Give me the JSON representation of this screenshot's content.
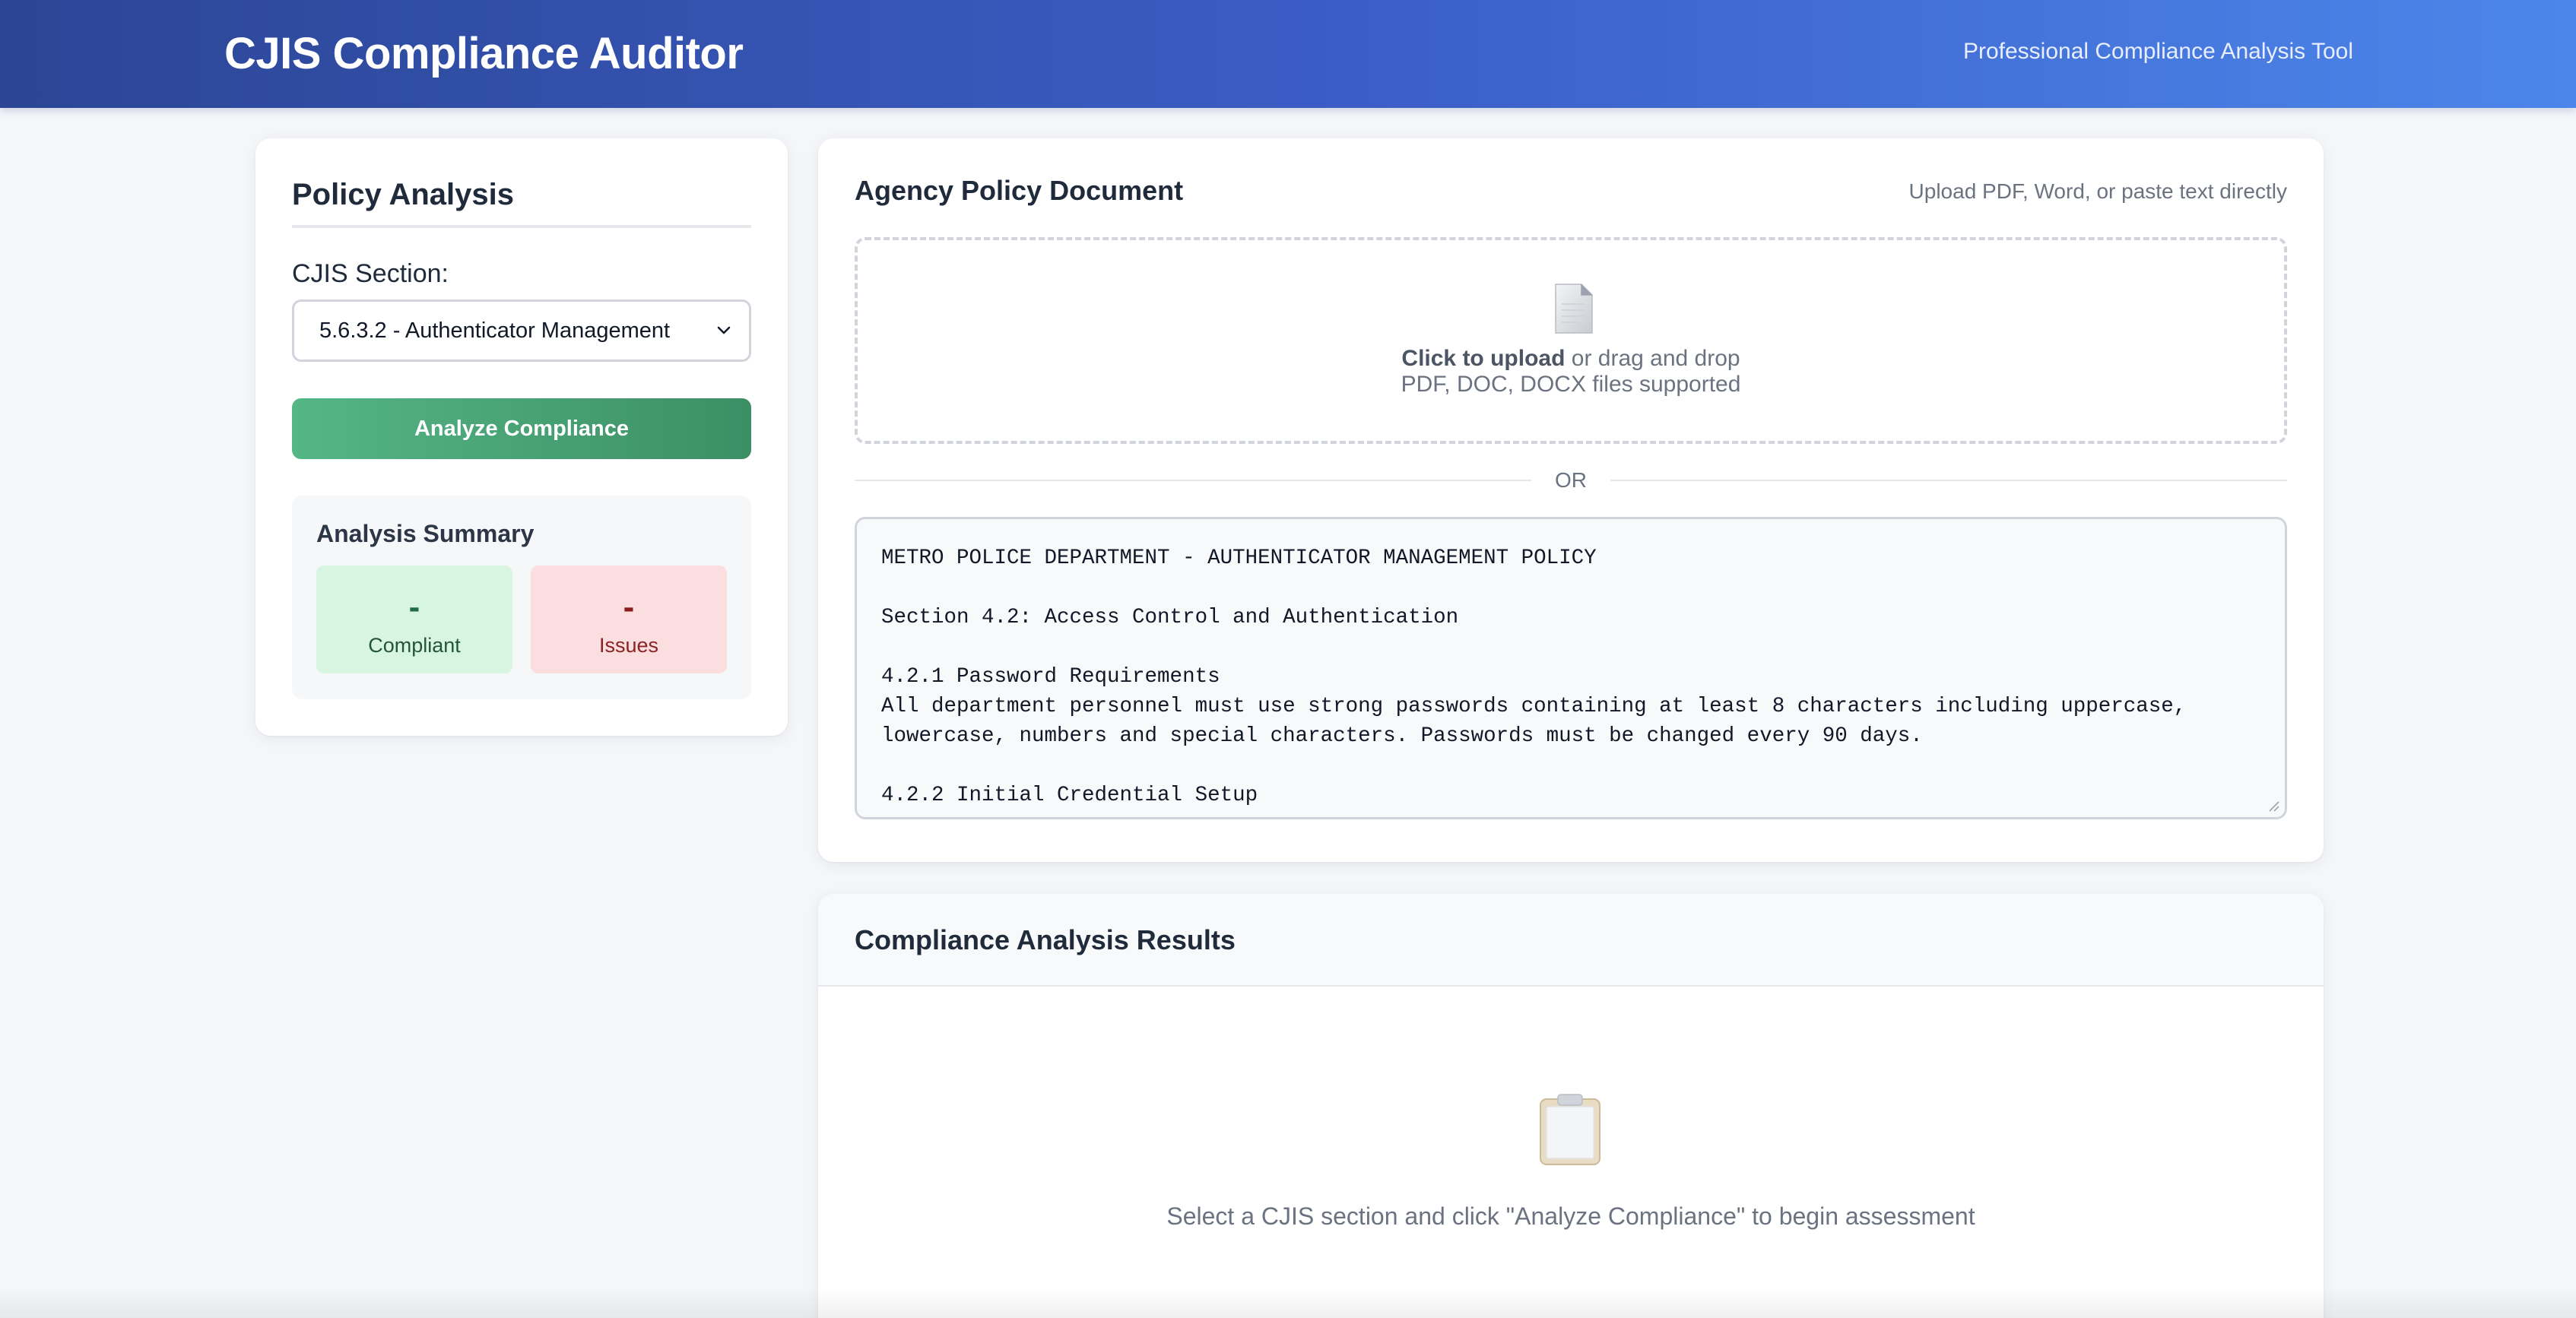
{
  "header": {
    "title": "CJIS Compliance Auditor",
    "subtitle": "Professional Compliance Analysis Tool"
  },
  "sidebar": {
    "title": "Policy Analysis",
    "section_label": "CJIS Section:",
    "section_selected": "5.6.3.2 - Authenticator Management",
    "analyze_button": "Analyze Compliance",
    "summary": {
      "title": "Analysis Summary",
      "compliant_value": "-",
      "compliant_label": "Compliant",
      "issues_value": "-",
      "issues_label": "Issues"
    }
  },
  "document": {
    "title": "Agency Policy Document",
    "hint": "Upload PDF, Word, or paste text directly",
    "upload": {
      "icon": "document-icon",
      "click_text": "Click to upload",
      "drag_text": " or drag and drop",
      "formats": "PDF, DOC, DOCX files supported"
    },
    "or_label": "OR",
    "policy_text": "METRO POLICE DEPARTMENT - AUTHENTICATOR MANAGEMENT POLICY\n\nSection 4.2: Access Control and Authentication\n\n4.2.1 Password Requirements\nAll department personnel must use strong passwords containing at least 8 characters including uppercase, lowercase, numbers and special characters. Passwords must be changed every 90 days.\n\n4.2.2 Initial Credential Setup"
  },
  "results": {
    "title": "Compliance Analysis Results",
    "empty_icon": "clipboard-icon",
    "empty_message": "Select a CJIS section and click \"Analyze Compliance\" to begin assessment"
  },
  "colors": {
    "header_gradient_start": "#2c4695",
    "header_gradient_end": "#4c86ea",
    "analyze_button": "#4aa576",
    "compliant_bg": "#d8f5e2",
    "issues_bg": "#fbdedf"
  }
}
